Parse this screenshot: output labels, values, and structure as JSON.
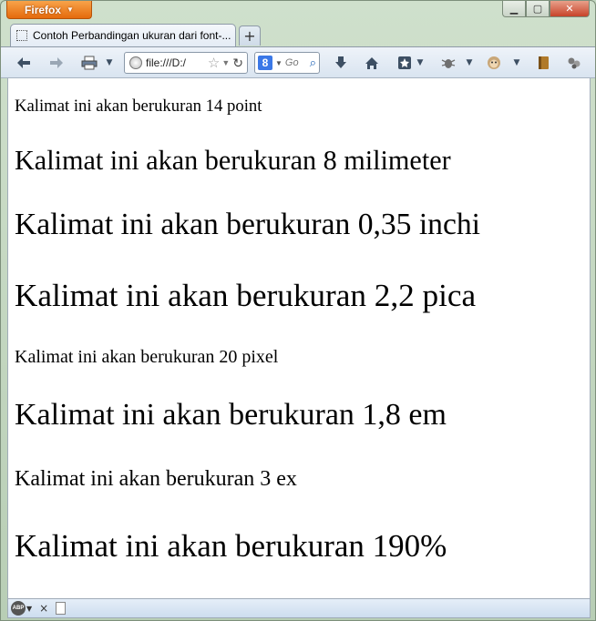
{
  "browser": {
    "menu_button": "Firefox",
    "tab_title": "Contoh Perbandingan ukuran dari font-...",
    "new_tab": "+",
    "url": "file:///D:/",
    "search_placeholder": "Go"
  },
  "content": {
    "lines": [
      {
        "text": "Kalimat ini akan berukuran 14 point",
        "font_size": "14pt"
      },
      {
        "text": "Kalimat ini akan berukuran 8 milimeter",
        "font_size": "8mm"
      },
      {
        "text": "Kalimat ini akan berukuran 0,35 inchi",
        "font_size": "0.35in"
      },
      {
        "text": "Kalimat ini akan berukuran 2,2 pica",
        "font_size": "2.2pc"
      },
      {
        "text": "Kalimat ini akan berukuran 20 pixel",
        "font_size": "20px"
      },
      {
        "text": "Kalimat ini akan berukuran 1,8 em",
        "font_size": "1.8em"
      },
      {
        "text": "Kalimat ini akan berukuran 3 ex",
        "font_size": "3ex"
      },
      {
        "text": "Kalimat ini akan berukuran 190%",
        "font_size": "190%"
      }
    ]
  },
  "status": {
    "abp_label": "ABP",
    "close_glyph": "×"
  },
  "icons": {
    "back": "back-arrow-icon",
    "forward": "forward-arrow-icon",
    "home": "home-icon",
    "bookmarks": "bookmark-star-icon",
    "downloads": "download-icon"
  }
}
